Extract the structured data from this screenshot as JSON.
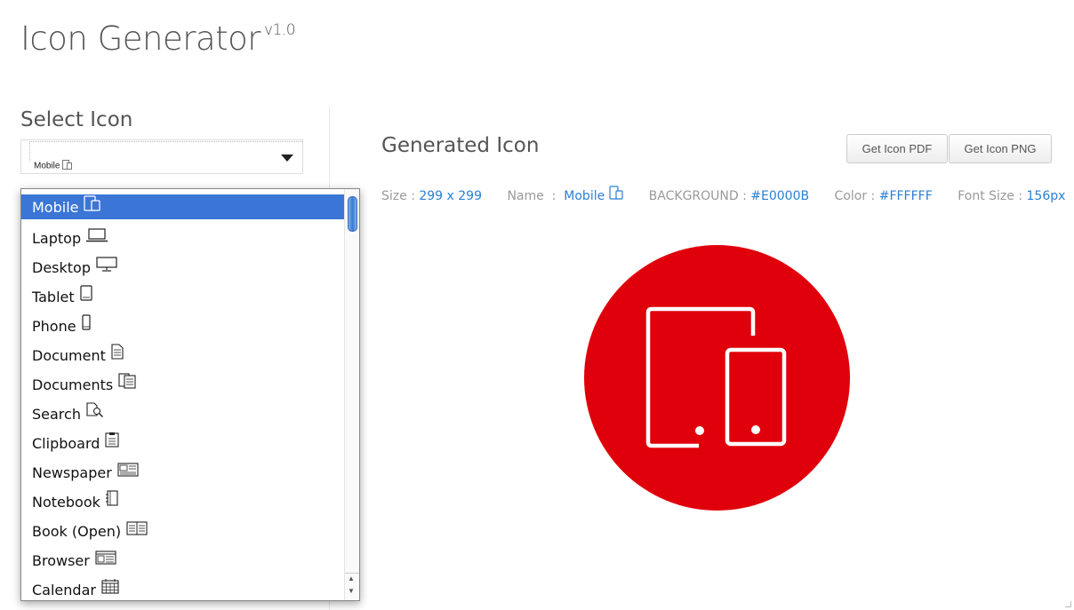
{
  "app": {
    "title": "Icon Generator",
    "version": "v1.0"
  },
  "select_icon": {
    "heading": "Select Icon",
    "selected_value": "Mobile",
    "options": [
      {
        "label": "Mobile",
        "icon": "mobile-tablet-icon",
        "selected": true
      },
      {
        "label": "Laptop",
        "icon": "laptop-icon"
      },
      {
        "label": "Desktop",
        "icon": "desktop-icon"
      },
      {
        "label": "Tablet",
        "icon": "tablet-icon"
      },
      {
        "label": "Phone",
        "icon": "phone-icon"
      },
      {
        "label": "Document",
        "icon": "document-icon"
      },
      {
        "label": "Documents",
        "icon": "documents-icon"
      },
      {
        "label": "Search",
        "icon": "search-document-icon"
      },
      {
        "label": "Clipboard",
        "icon": "clipboard-icon"
      },
      {
        "label": "Newspaper",
        "icon": "newspaper-icon"
      },
      {
        "label": "Notebook",
        "icon": "notebook-icon"
      },
      {
        "label": "Book  (Open)",
        "icon": "open-book-icon"
      },
      {
        "label": "Browser",
        "icon": "browser-icon"
      },
      {
        "label": "Calendar",
        "icon": "calendar-icon"
      }
    ]
  },
  "generated": {
    "heading": "Generated Icon",
    "buttons": {
      "pdf": "Get Icon PDF",
      "png": "Get Icon PNG"
    },
    "info": {
      "size_label": "Size :",
      "size_value": "299 x 299",
      "name_label": "Name  :",
      "name_value": "Mobile",
      "background_label": "BACKGROUND :",
      "background_value": "#E0000B",
      "color_label": "Color :",
      "color_value": "#FFFFFF",
      "font_size_label": "Font Size :",
      "font_size_value": "156px"
    },
    "preview": {
      "background": "#E0000B",
      "color": "#FFFFFF",
      "icon": "mobile-tablet-icon"
    }
  }
}
